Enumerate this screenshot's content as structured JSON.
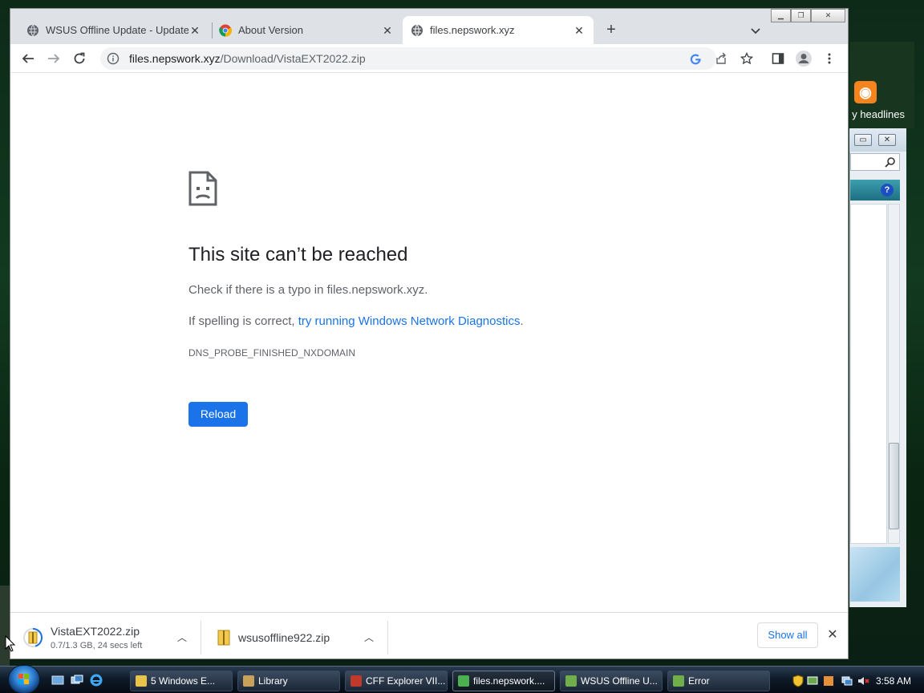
{
  "gadget": {
    "label": "y headlines"
  },
  "tabs": [
    {
      "title": "WSUS Offline Update - Update M",
      "icon": "globe-icon"
    },
    {
      "title": "About Version",
      "icon": "chrome-icon"
    },
    {
      "title": "files.nepswork.xyz",
      "icon": "globe-icon",
      "active": true
    }
  ],
  "omnibox": {
    "host": "files.nepswork.xyz",
    "path": "/Download/VistaEXT2022.zip"
  },
  "error_page": {
    "title": "This site can’t be reached",
    "line1": "Check if there is a typo in files.nepswork.xyz.",
    "line2_prefix": "If spelling is correct, ",
    "line2_link": "try running Windows Network Diagnostics",
    "line2_suffix": ".",
    "code": "DNS_PROBE_FINISHED_NXDOMAIN",
    "reload_label": "Reload"
  },
  "downloads": [
    {
      "name": "VistaEXT2022.zip",
      "status": "0.7/1.3 GB, 24 secs left",
      "progress": 0.54
    },
    {
      "name": "wsusoffline922.zip",
      "status": ""
    }
  ],
  "shelf": {
    "show_all_label": "Show all"
  },
  "taskbar": {
    "tasks": [
      {
        "label": "5 Windows E...",
        "icon_color": "#e9c44b"
      },
      {
        "label": "Library",
        "icon_color": "#c8a15a"
      },
      {
        "label": "CFF Explorer VII...",
        "icon_color": "#c0392b"
      },
      {
        "label": "files.nepswork....",
        "icon_color": "#4caf50",
        "active": true
      },
      {
        "label": "WSUS Offline U...",
        "icon_color": "#6fae4a"
      },
      {
        "label": "Error",
        "icon_color": "#6fae4a"
      }
    ],
    "clock": "3:58 AM"
  },
  "colors": {
    "accent": "#1a73e8",
    "link": "#1a73e8",
    "tabstrip": "#dee1e6"
  }
}
